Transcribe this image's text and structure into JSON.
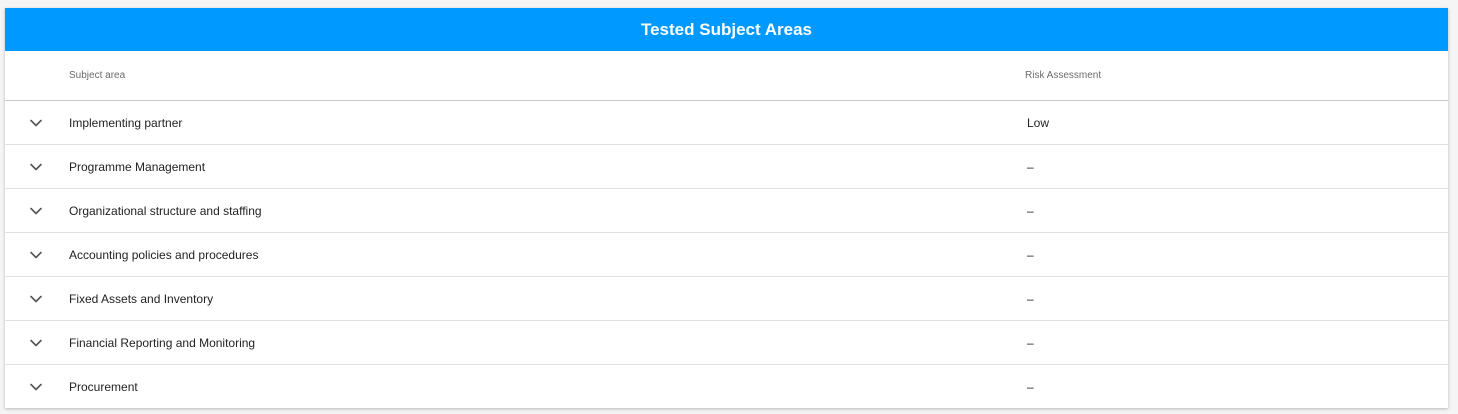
{
  "card": {
    "title": "Tested Subject Areas",
    "header_color": "#0099ff"
  },
  "table": {
    "columns": {
      "subject": "Subject area",
      "risk": "Risk Assessment"
    },
    "rows": [
      {
        "subject": "Implementing partner",
        "risk": "Low"
      },
      {
        "subject": "Programme Management",
        "risk": "–"
      },
      {
        "subject": "Organizational structure and staffing",
        "risk": "–"
      },
      {
        "subject": "Accounting policies and procedures",
        "risk": "–"
      },
      {
        "subject": "Fixed Assets and Inventory",
        "risk": "–"
      },
      {
        "subject": "Financial Reporting and Monitoring",
        "risk": "–"
      },
      {
        "subject": "Procurement",
        "risk": "–"
      }
    ],
    "row_icon": "chevron-down-icon"
  }
}
